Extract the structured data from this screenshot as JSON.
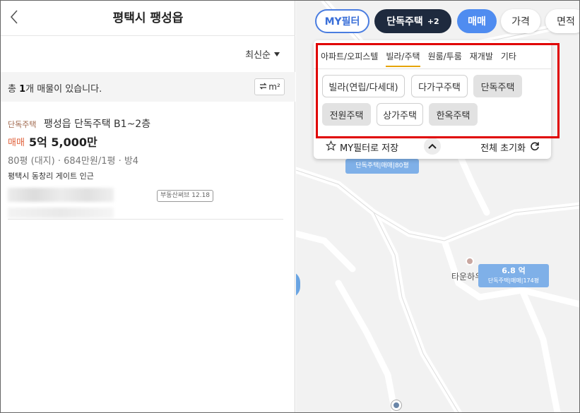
{
  "header": {
    "title": "평택시 팽성읍"
  },
  "sort": {
    "label": "최신순"
  },
  "summary": {
    "prefix": "총 ",
    "count": "1",
    "suffix": "개 매물이 있습니다.",
    "unit_label": "m²"
  },
  "listing": {
    "type": "단독주택",
    "name": "팽성읍 단독주택 B1~2층",
    "deal": "매매",
    "price": "5억 5,000만",
    "spec": "80평 (대지) · 684만원/1평 · 방4",
    "location": "평택시 동창리 게이트 인근",
    "agent_badge": "부동산써브 12.18"
  },
  "chips": {
    "my_filter": "MY필터",
    "type": "단독주택",
    "type_extra": "+2",
    "deal": "매매",
    "price": "가격",
    "area": "면적"
  },
  "filter": {
    "tabs": [
      "아파트/오피스텔",
      "빌라/주택",
      "원룸/투룸",
      "재개발",
      "기타"
    ],
    "active_tab": "빌라/주택",
    "options": [
      {
        "label": "빌라(연립/다세대)",
        "selected": false
      },
      {
        "label": "다가구주택",
        "selected": false
      },
      {
        "label": "단독주택",
        "selected": true
      },
      {
        "label": "전원주택",
        "selected": true
      },
      {
        "label": "상가주택",
        "selected": false
      },
      {
        "label": "한옥주택",
        "selected": true
      }
    ],
    "save_label": "MY필터로 저장",
    "reset_label": "전체 초기화"
  },
  "map": {
    "cluster1_label": "단독주택|매매|80평",
    "cluster2_price": "6.8 억",
    "cluster2_label": "단독주택|매매|174평",
    "poi_label": "타운하우스"
  },
  "colors": {
    "accent_blue": "#4f8cf0",
    "dark_chip": "#1e2a3e",
    "highlight_red": "#e00000",
    "deal_orange": "#e0603a"
  }
}
